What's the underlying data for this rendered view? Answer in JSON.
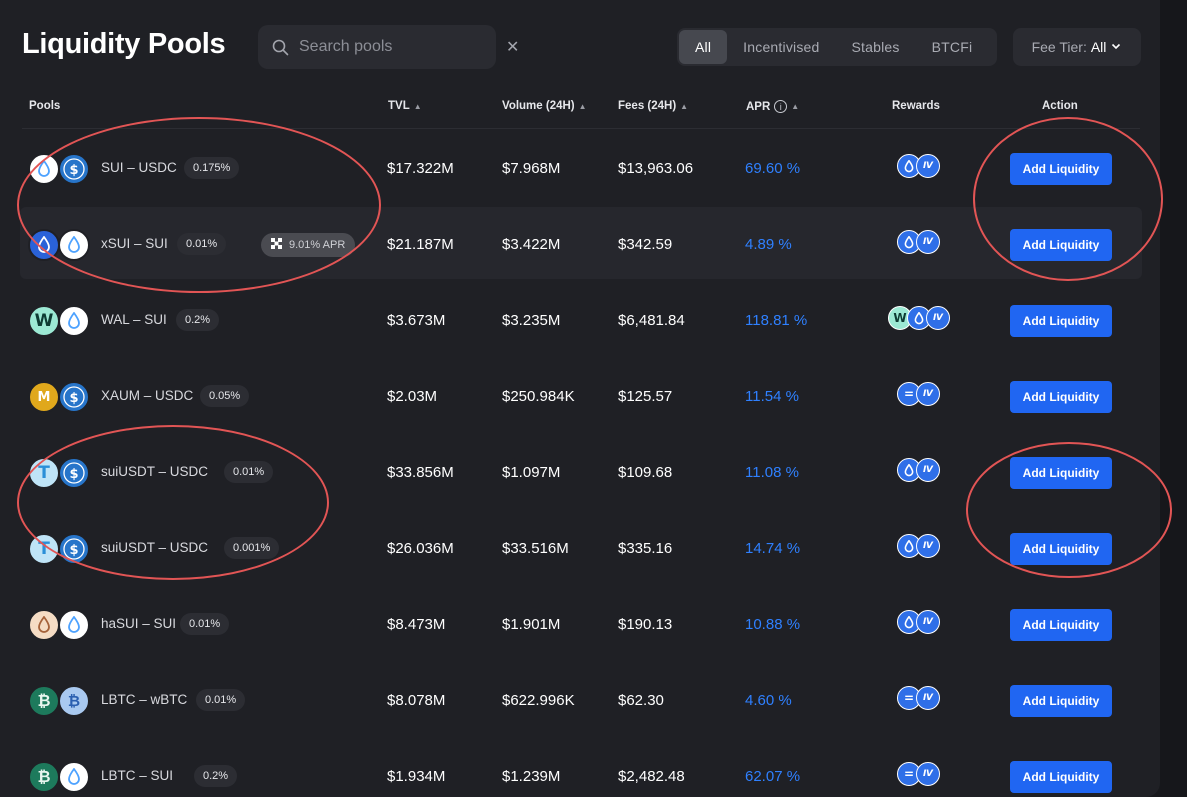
{
  "page": {
    "title": "Liquidity Pools",
    "search_placeholder": "Search pools",
    "filters": [
      "All",
      "Incentivised",
      "Stables",
      "BTCFi"
    ],
    "fee_tier_label": "Fee Tier:",
    "fee_tier_value": "All"
  },
  "columns": {
    "pools": "Pools",
    "tvl": "TVL",
    "volume": "Volume (24H)",
    "fees": "Fees (24H)",
    "apr": "APR",
    "rewards": "Rewards",
    "action": "Action"
  },
  "rows": [
    {
      "pair": "SUI – USDC",
      "fee": "0.175%",
      "tvl": "$17.322M",
      "volume": "$7.968M",
      "fees": "$13,963.06",
      "apr": "69.60 %",
      "action": "Add Liquidity",
      "tokens": [
        "sui-icon",
        "usdc-icon"
      ],
      "rewards": [
        "sui-reward-icon",
        "points-reward-icon"
      ]
    },
    {
      "pair": "xSUI – SUI",
      "fee": "0.01%",
      "extra_apr": "9.01% APR",
      "tvl": "$21.187M",
      "volume": "$3.422M",
      "fees": "$342.59",
      "apr": "4.89 %",
      "action": "Add Liquidity",
      "tokens": [
        "xsui-icon",
        "sui-icon"
      ],
      "rewards": [
        "sui-reward-icon",
        "points-reward-icon"
      ]
    },
    {
      "pair": "WAL – SUI",
      "fee": "0.2%",
      "tvl": "$3.673M",
      "volume": "$3.235M",
      "fees": "$6,481.84",
      "apr": "118.81 %",
      "action": "Add Liquidity",
      "tokens": [
        "wal-icon",
        "sui-icon"
      ],
      "rewards": [
        "wal-reward-icon",
        "sui-reward-icon",
        "points-reward-icon"
      ]
    },
    {
      "pair": "XAUM – USDC",
      "fee": "0.05%",
      "tvl": "$2.03M",
      "volume": "$250.984K",
      "fees": "$125.57",
      "apr": "11.54 %",
      "action": "Add Liquidity",
      "tokens": [
        "xaum-icon",
        "usdc-icon"
      ],
      "rewards": [
        "equal-reward-icon",
        "points-reward-icon"
      ]
    },
    {
      "pair": "suiUSDT – USDC",
      "fee": "0.01%",
      "tvl": "$33.856M",
      "volume": "$1.097M",
      "fees": "$109.68",
      "apr": "11.08 %",
      "action": "Add Liquidity",
      "tokens": [
        "usdt-icon",
        "usdc-icon"
      ],
      "rewards": [
        "sui-reward-icon",
        "points-reward-icon"
      ]
    },
    {
      "pair": "suiUSDT – USDC",
      "fee": "0.001%",
      "tvl": "$26.036M",
      "volume": "$33.516M",
      "fees": "$335.16",
      "apr": "14.74 %",
      "action": "Add Liquidity",
      "tokens": [
        "usdt-icon",
        "usdc-icon"
      ],
      "rewards": [
        "sui-reward-icon",
        "points-reward-icon"
      ]
    },
    {
      "pair": "haSUI – SUI",
      "fee": "0.01%",
      "tvl": "$8.473M",
      "volume": "$1.901M",
      "fees": "$190.13",
      "apr": "10.88 %",
      "action": "Add Liquidity",
      "tokens": [
        "hasui-icon",
        "sui-icon"
      ],
      "rewards": [
        "sui-reward-icon",
        "points-reward-icon"
      ]
    },
    {
      "pair": "LBTC – wBTC",
      "fee": "0.01%",
      "tvl": "$8.078M",
      "volume": "$622.996K",
      "fees": "$62.30",
      "apr": "4.60 %",
      "action": "Add Liquidity",
      "tokens": [
        "lbtc-icon",
        "wbtc-icon"
      ],
      "rewards": [
        "equal-reward-icon",
        "points-reward-icon"
      ]
    },
    {
      "pair": "LBTC – SUI",
      "fee": "0.2%",
      "tvl": "$1.934M",
      "volume": "$1.239M",
      "fees": "$2,482.48",
      "apr": "62.07 %",
      "action": "Add Liquidity",
      "tokens": [
        "lbtc-icon",
        "sui-icon"
      ],
      "rewards": [
        "equal-reward-icon",
        "points-reward-icon"
      ]
    }
  ],
  "colors": {
    "accent": "#2066f2",
    "apr": "#2f80ff",
    "annotation": "#e25555",
    "background": "#1f2025"
  }
}
